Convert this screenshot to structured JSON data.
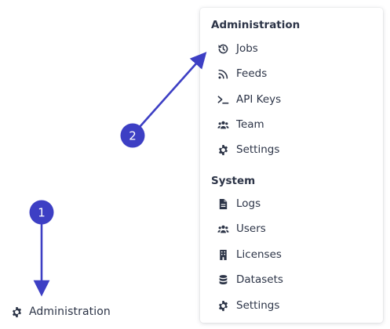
{
  "sidebar": {
    "administration_label": "Administration",
    "administration_icon": "gear-icon"
  },
  "menu": {
    "sections": [
      {
        "title": "Administration",
        "items": [
          {
            "label": "Jobs",
            "icon": "history-icon"
          },
          {
            "label": "Feeds",
            "icon": "rss-feed-icon"
          },
          {
            "label": "API Keys",
            "icon": "terminal-icon"
          },
          {
            "label": "Team",
            "icon": "users-icon"
          },
          {
            "label": "Settings",
            "icon": "gear-icon"
          }
        ]
      },
      {
        "title": "System",
        "items": [
          {
            "label": "Logs",
            "icon": "file-icon"
          },
          {
            "label": "Users",
            "icon": "users-icon"
          },
          {
            "label": "Licenses",
            "icon": "building-icon"
          },
          {
            "label": "Datasets",
            "icon": "database-icon"
          },
          {
            "label": "Settings",
            "icon": "gear-icon"
          }
        ]
      }
    ]
  },
  "annotations": {
    "badges": [
      {
        "number": "1"
      },
      {
        "number": "2"
      }
    ],
    "color": "#3d3fc4"
  }
}
